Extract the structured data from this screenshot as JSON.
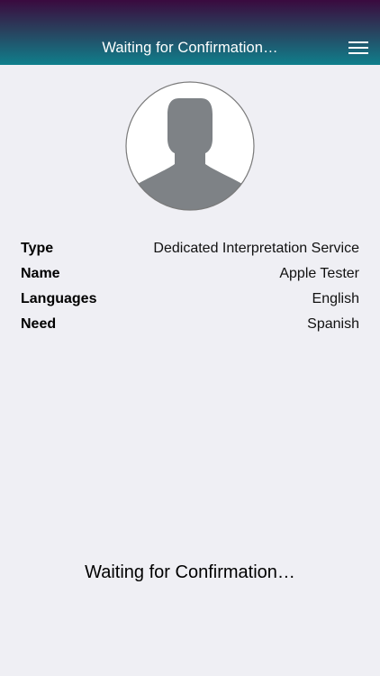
{
  "header": {
    "title": "Waiting for Confirmation…",
    "menu_icon": "hamburger-menu-icon",
    "gradient_colors": [
      "#3a0a3f",
      "#2a3f5c",
      "#0f7f8c"
    ]
  },
  "avatar": {
    "icon": "user-placeholder-icon",
    "silhouette_color": "#7e8286"
  },
  "details": [
    {
      "label": "Type",
      "value": "Dedicated Interpretation Service"
    },
    {
      "label": "Name",
      "value": "Apple Tester"
    },
    {
      "label": "Languages",
      "value": "English"
    },
    {
      "label": "Need",
      "value": "Spanish"
    }
  ],
  "status": {
    "message": "Waiting for Confirmation…"
  }
}
